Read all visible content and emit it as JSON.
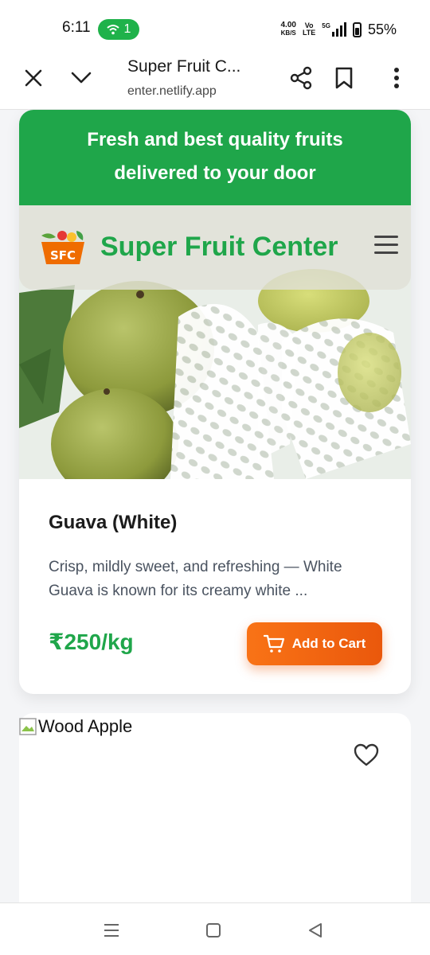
{
  "status": {
    "time": "6:11",
    "hotspot_count": "1",
    "net_speed_value": "4.00",
    "net_speed_unit": "KB/S",
    "volte_top": "Vo",
    "volte_bottom": "LTE",
    "network": "5G",
    "battery": "55%"
  },
  "browser": {
    "page_title": "Super Fruit C...",
    "url": "enter.netlify.app"
  },
  "promo": {
    "line1": "Fresh and best quality fruits",
    "line2": "delivered to your door"
  },
  "header": {
    "logo_text": "SFC",
    "brand_name": "Super Fruit Center"
  },
  "products": [
    {
      "name": "Guava (White)",
      "description": "Crisp, mildly sweet, and refreshing — White Guava is known for its creamy white ...",
      "price": "₹250/kg",
      "cta": "Add to Cart"
    },
    {
      "image_alt": "Wood Apple"
    }
  ],
  "colors": {
    "brand_green": "#1fa64a",
    "cta_orange": "#f97316"
  }
}
